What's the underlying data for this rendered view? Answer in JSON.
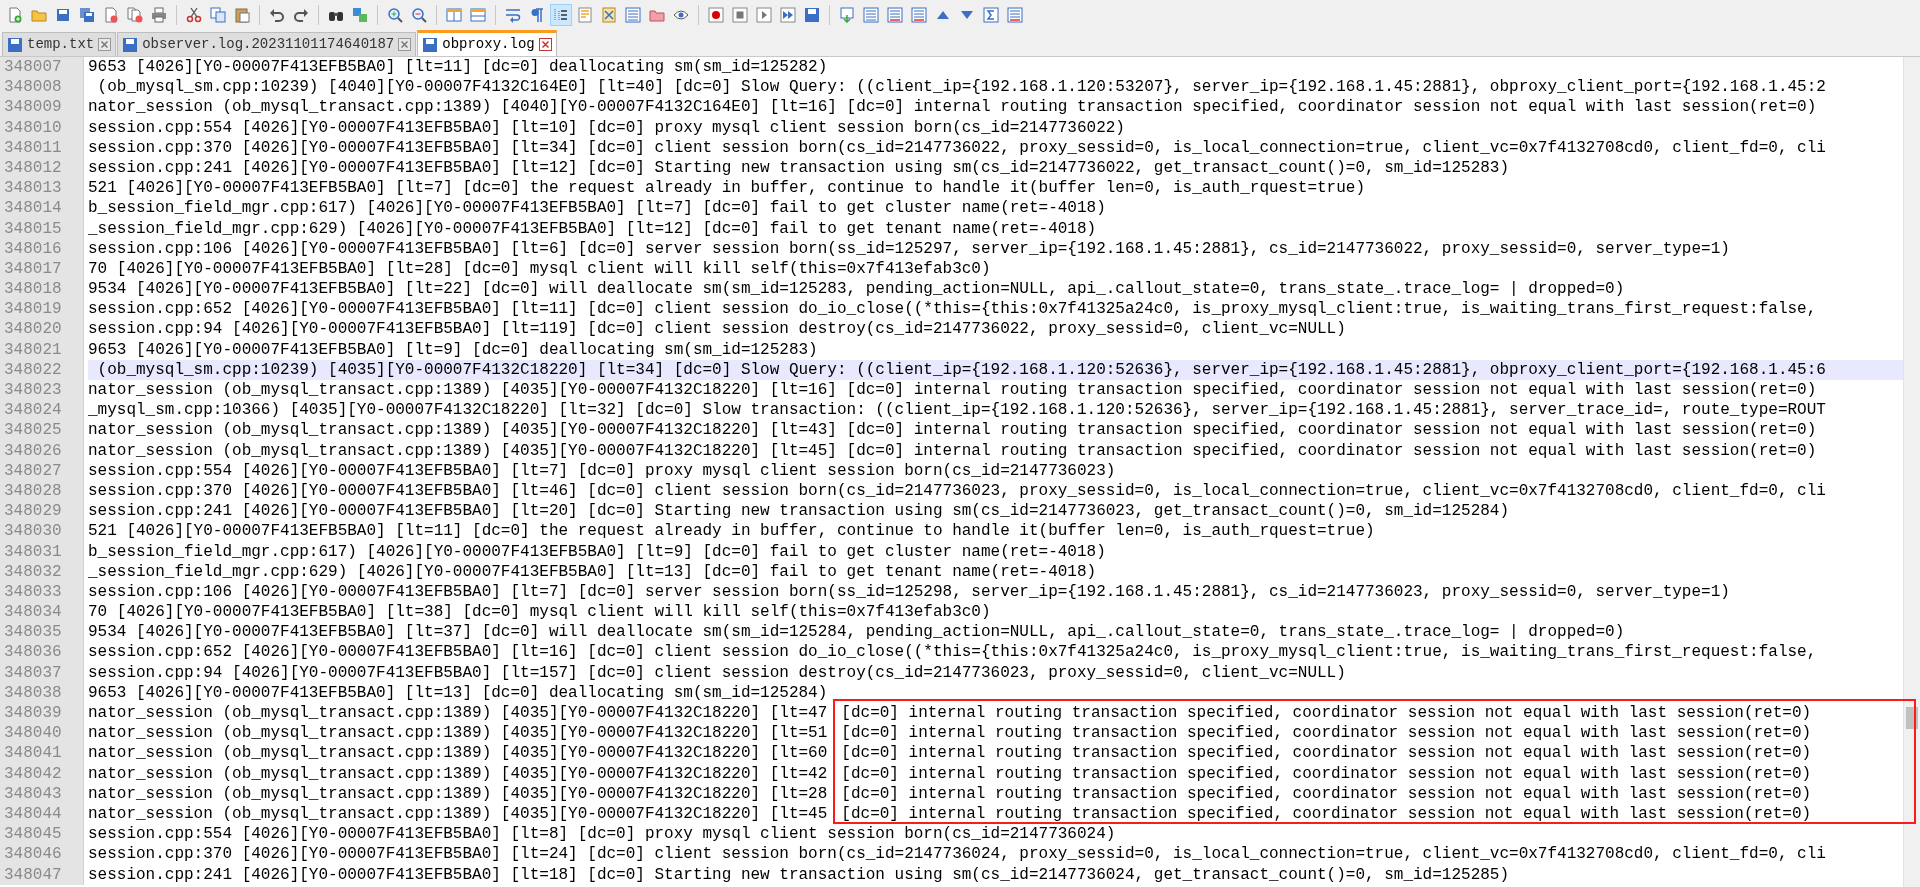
{
  "toolbar": [
    {
      "kind": "new",
      "pressed": false
    },
    {
      "kind": "open",
      "pressed": false
    },
    {
      "kind": "save",
      "pressed": false
    },
    {
      "kind": "save_all",
      "pressed": false
    },
    {
      "kind": "close",
      "pressed": false
    },
    {
      "kind": "close_all",
      "pressed": false
    },
    {
      "kind": "print",
      "pressed": false
    },
    {
      "kind": "separator"
    },
    {
      "kind": "cut",
      "pressed": false
    },
    {
      "kind": "copy",
      "pressed": false
    },
    {
      "kind": "paste",
      "pressed": false
    },
    {
      "kind": "separator"
    },
    {
      "kind": "undo",
      "pressed": false
    },
    {
      "kind": "redo",
      "pressed": false
    },
    {
      "kind": "separator"
    },
    {
      "kind": "find",
      "pressed": false
    },
    {
      "kind": "replace",
      "pressed": false
    },
    {
      "kind": "separator"
    },
    {
      "kind": "zoom_in",
      "pressed": false
    },
    {
      "kind": "zoom_out",
      "pressed": false
    },
    {
      "kind": "separator"
    },
    {
      "kind": "sync_v",
      "pressed": false
    },
    {
      "kind": "sync_h",
      "pressed": false
    },
    {
      "kind": "separator"
    },
    {
      "kind": "wrap",
      "pressed": false
    },
    {
      "kind": "pilcrow",
      "pressed": false
    },
    {
      "kind": "indent",
      "pressed": true
    },
    {
      "kind": "lang",
      "pressed": false
    },
    {
      "kind": "map",
      "pressed": false
    },
    {
      "kind": "list",
      "pressed": false
    },
    {
      "kind": "folder_ws",
      "pressed": false
    },
    {
      "kind": "eye",
      "pressed": false
    },
    {
      "kind": "separator"
    },
    {
      "kind": "record",
      "pressed": false
    },
    {
      "kind": "stop",
      "pressed": false
    },
    {
      "kind": "play",
      "pressed": false
    },
    {
      "kind": "play_multi",
      "pressed": false
    },
    {
      "kind": "save_macro",
      "pressed": false
    },
    {
      "kind": "separator"
    },
    {
      "kind": "bookmark",
      "pressed": false
    },
    {
      "kind": "list",
      "pressed": false
    },
    {
      "kind": "list_red",
      "pressed": false
    },
    {
      "kind": "list_red",
      "pressed": false
    },
    {
      "kind": "up",
      "pressed": false
    },
    {
      "kind": "down",
      "pressed": false
    },
    {
      "kind": "sigma",
      "pressed": false
    },
    {
      "kind": "list_red",
      "pressed": false
    }
  ],
  "tabs": [
    {
      "label": "temp.txt",
      "selected": false
    },
    {
      "label": "observer.log.20231101174640187",
      "selected": false
    },
    {
      "label": "obproxy.log",
      "selected": true
    }
  ],
  "lines": [
    {
      "number": "348007",
      "text": "9653 [4026][Y0-00007F413EFB5BA0] [lt=11] [dc=0] deallocating sm(sm_id=125282)",
      "current": false
    },
    {
      "number": "348008",
      "text": " (ob_mysql_sm.cpp:10239) [4040][Y0-00007F4132C164E0] [lt=40] [dc=0] Slow Query: ((client_ip={192.168.1.120:53207}, server_ip={192.168.1.45:2881}, obproxy_client_port={192.168.1.45:2",
      "current": false
    },
    {
      "number": "348009",
      "text": "nator_session (ob_mysql_transact.cpp:1389) [4040][Y0-00007F4132C164E0] [lt=16] [dc=0] internal routing transaction specified, coordinator session not equal with last session(ret=0)",
      "current": false
    },
    {
      "number": "348010",
      "text": "session.cpp:554 [4026][Y0-00007F413EFB5BA0] [lt=10] [dc=0] proxy mysql client session born(cs_id=2147736022)",
      "current": false
    },
    {
      "number": "348011",
      "text": "session.cpp:370 [4026][Y0-00007F413EFB5BA0] [lt=34] [dc=0] client session born(cs_id=2147736022, proxy_sessid=0, is_local_connection=true, client_vc=0x7f4132708cd0, client_fd=0, cli",
      "current": false
    },
    {
      "number": "348012",
      "text": "session.cpp:241 [4026][Y0-00007F413EFB5BA0] [lt=12] [dc=0] Starting new transaction using sm(cs_id=2147736022, get_transact_count()=0, sm_id=125283)",
      "current": false
    },
    {
      "number": "348013",
      "text": "521 [4026][Y0-00007F413EFB5BA0] [lt=7] [dc=0] the request already in buffer, continue to handle it(buffer len=0, is_auth_rquest=true)",
      "current": false
    },
    {
      "number": "348014",
      "text": "b_session_field_mgr.cpp:617) [4026][Y0-00007F413EFB5BA0] [lt=7] [dc=0] fail to get cluster name(ret=-4018)",
      "current": false
    },
    {
      "number": "348015",
      "text": "_session_field_mgr.cpp:629) [4026][Y0-00007F413EFB5BA0] [lt=12] [dc=0] fail to get tenant name(ret=-4018)",
      "current": false
    },
    {
      "number": "348016",
      "text": "session.cpp:106 [4026][Y0-00007F413EFB5BA0] [lt=6] [dc=0] server session born(ss_id=125297, server_ip={192.168.1.45:2881}, cs_id=2147736022, proxy_sessid=0, server_type=1)",
      "current": false
    },
    {
      "number": "348017",
      "text": "70 [4026][Y0-00007F413EFB5BA0] [lt=28] [dc=0] mysql client will kill self(this=0x7f413efab3c0)",
      "current": false
    },
    {
      "number": "348018",
      "text": "9534 [4026][Y0-00007F413EFB5BA0] [lt=22] [dc=0] will deallocate sm(sm_id=125283, pending_action=NULL, api_.callout_state=0, trans_state_.trace_log= | dropped=0)",
      "current": false
    },
    {
      "number": "348019",
      "text": "session.cpp:652 [4026][Y0-00007F413EFB5BA0] [lt=11] [dc=0] client session do_io_close((*this={this:0x7f41325a24c0, is_proxy_mysql_client:true, is_waiting_trans_first_request:false,",
      "current": false
    },
    {
      "number": "348020",
      "text": "session.cpp:94 [4026][Y0-00007F413EFB5BA0] [lt=119] [dc=0] client session destroy(cs_id=2147736022, proxy_sessid=0, client_vc=NULL)",
      "current": false
    },
    {
      "number": "348021",
      "text": "9653 [4026][Y0-00007F413EFB5BA0] [lt=9] [dc=0] deallocating sm(sm_id=125283)",
      "current": false
    },
    {
      "number": "348022",
      "text": " (ob_mysql_sm.cpp:10239) [4035][Y0-00007F4132C18220] [lt=34] [dc=0] Slow Query: ((client_ip={192.168.1.120:52636}, server_ip={192.168.1.45:2881}, obproxy_client_port={192.168.1.45:6",
      "current": true
    },
    {
      "number": "348023",
      "text": "nator_session (ob_mysql_transact.cpp:1389) [4035][Y0-00007F4132C18220] [lt=16] [dc=0] internal routing transaction specified, coordinator session not equal with last session(ret=0)",
      "current": false
    },
    {
      "number": "348024",
      "text": "_mysql_sm.cpp:10366) [4035][Y0-00007F4132C18220] [lt=32] [dc=0] Slow transaction: ((client_ip={192.168.1.120:52636}, server_ip={192.168.1.45:2881}, server_trace_id=, route_type=ROUT",
      "current": false
    },
    {
      "number": "348025",
      "text": "nator_session (ob_mysql_transact.cpp:1389) [4035][Y0-00007F4132C18220] [lt=43] [dc=0] internal routing transaction specified, coordinator session not equal with last session(ret=0)",
      "current": false
    },
    {
      "number": "348026",
      "text": "nator_session (ob_mysql_transact.cpp:1389) [4035][Y0-00007F4132C18220] [lt=45] [dc=0] internal routing transaction specified, coordinator session not equal with last session(ret=0)",
      "current": false
    },
    {
      "number": "348027",
      "text": "session.cpp:554 [4026][Y0-00007F413EFB5BA0] [lt=7] [dc=0] proxy mysql client session born(cs_id=2147736023)",
      "current": false
    },
    {
      "number": "348028",
      "text": "session.cpp:370 [4026][Y0-00007F413EFB5BA0] [lt=46] [dc=0] client session born(cs_id=2147736023, proxy_sessid=0, is_local_connection=true, client_vc=0x7f4132708cd0, client_fd=0, cli",
      "current": false
    },
    {
      "number": "348029",
      "text": "session.cpp:241 [4026][Y0-00007F413EFB5BA0] [lt=20] [dc=0] Starting new transaction using sm(cs_id=2147736023, get_transact_count()=0, sm_id=125284)",
      "current": false
    },
    {
      "number": "348030",
      "text": "521 [4026][Y0-00007F413EFB5BA0] [lt=11] [dc=0] the request already in buffer, continue to handle it(buffer len=0, is_auth_rquest=true)",
      "current": false
    },
    {
      "number": "348031",
      "text": "b_session_field_mgr.cpp:617) [4026][Y0-00007F413EFB5BA0] [lt=9] [dc=0] fail to get cluster name(ret=-4018)",
      "current": false
    },
    {
      "number": "348032",
      "text": "_session_field_mgr.cpp:629) [4026][Y0-00007F413EFB5BA0] [lt=13] [dc=0] fail to get tenant name(ret=-4018)",
      "current": false
    },
    {
      "number": "348033",
      "text": "session.cpp:106 [4026][Y0-00007F413EFB5BA0] [lt=7] [dc=0] server session born(ss_id=125298, server_ip={192.168.1.45:2881}, cs_id=2147736023, proxy_sessid=0, server_type=1)",
      "current": false
    },
    {
      "number": "348034",
      "text": "70 [4026][Y0-00007F413EFB5BA0] [lt=38] [dc=0] mysql client will kill self(this=0x7f413efab3c0)",
      "current": false
    },
    {
      "number": "348035",
      "text": "9534 [4026][Y0-00007F413EFB5BA0] [lt=37] [dc=0] will deallocate sm(sm_id=125284, pending_action=NULL, api_.callout_state=0, trans_state_.trace_log= | dropped=0)",
      "current": false
    },
    {
      "number": "348036",
      "text": "session.cpp:652 [4026][Y0-00007F413EFB5BA0] [lt=16] [dc=0] client session do_io_close((*this={this:0x7f41325a24c0, is_proxy_mysql_client:true, is_waiting_trans_first_request:false,",
      "current": false
    },
    {
      "number": "348037",
      "text": "session.cpp:94 [4026][Y0-00007F413EFB5BA0] [lt=157] [dc=0] client session destroy(cs_id=2147736023, proxy_sessid=0, client_vc=NULL)",
      "current": false
    },
    {
      "number": "348038",
      "text": "9653 [4026][Y0-00007F413EFB5BA0] [lt=13] [dc=0] deallocating sm(sm_id=125284)",
      "current": false
    },
    {
      "number": "348039",
      "text": "nator_session (ob_mysql_transact.cpp:1389) [4035][Y0-00007F4132C18220] [lt=47",
      "marked": "[dc=0] internal routing transaction specified, coordinator session not equal with last session(ret=0)",
      "current": false
    },
    {
      "number": "348040",
      "text": "nator_session (ob_mysql_transact.cpp:1389) [4035][Y0-00007F4132C18220] [lt=51",
      "marked": "[dc=0] internal routing transaction specified, coordinator session not equal with last session(ret=0)",
      "current": false
    },
    {
      "number": "348041",
      "text": "nator_session (ob_mysql_transact.cpp:1389) [4035][Y0-00007F4132C18220] [lt=60",
      "marked": "[dc=0] internal routing transaction specified, coordinator session not equal with last session(ret=0)",
      "current": false
    },
    {
      "number": "348042",
      "text": "nator_session (ob_mysql_transact.cpp:1389) [4035][Y0-00007F4132C18220] [lt=42",
      "marked": "[dc=0] internal routing transaction specified, coordinator session not equal with last session(ret=0)",
      "current": false
    },
    {
      "number": "348043",
      "text": "nator_session (ob_mysql_transact.cpp:1389) [4035][Y0-00007F4132C18220] [lt=28",
      "marked": "[dc=0] internal routing transaction specified, coordinator session not equal with last session(ret=0)",
      "current": false
    },
    {
      "number": "348044",
      "text": "nator_session (ob_mysql_transact.cpp:1389) [4035][Y0-00007F4132C18220] [lt=45",
      "marked": "[dc=0] internal routing transaction specified, coordinator session not equal with last session(ret=0)",
      "current": false
    },
    {
      "number": "348045",
      "text": "session.cpp:554 [4026][Y0-00007F413EFB5BA0] [lt=8] [dc=0] proxy mysql client session born(cs_id=2147736024)",
      "current": false
    },
    {
      "number": "348046",
      "text": "session.cpp:370 [4026][Y0-00007F413EFB5BA0] [lt=24] [dc=0] client session born(cs_id=2147736024, proxy_sessid=0, is_local_connection=true, client_vc=0x7f4132708cd0, client_fd=0, cli",
      "current": false
    },
    {
      "number": "348047",
      "text": "session.cpp:241 [4026][Y0-00007F413EFB5BA0] [lt=18] [dc=0] Starting new transaction using sm(cs_id=2147736024, get_transact_count()=0, sm_id=125285)",
      "current": false
    }
  ]
}
